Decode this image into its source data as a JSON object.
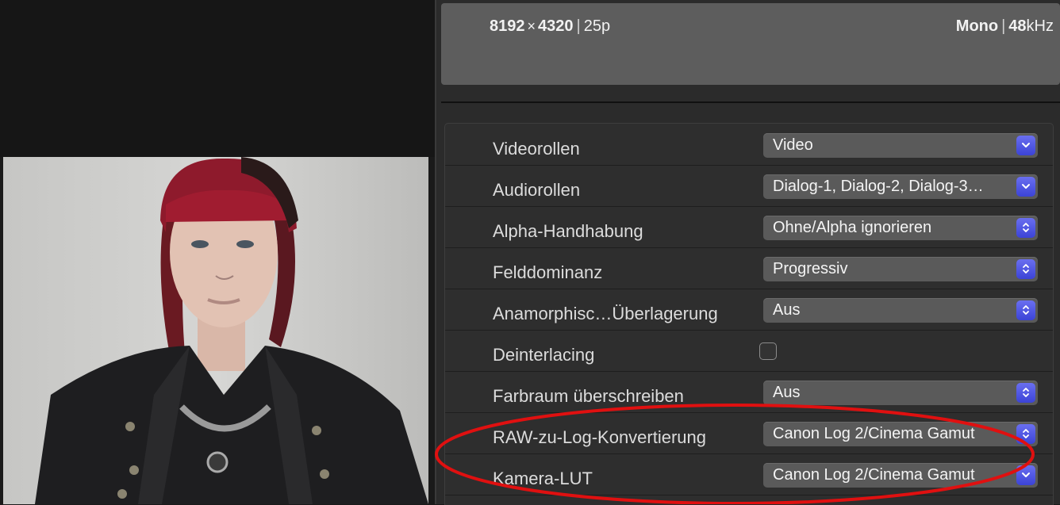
{
  "header": {
    "width": "8192",
    "times": "×",
    "height": "4320",
    "sep": "|",
    "framerate": "25p",
    "channels": "Mono",
    "samplerate_value": "48",
    "samplerate_unit": "kHz"
  },
  "properties": [
    {
      "label": "Videorollen",
      "value": "Video",
      "control": "dropdown"
    },
    {
      "label": "Audiorollen",
      "value": "Dialog-1, Dialog-2, Dialog-3…",
      "control": "dropdown"
    },
    {
      "label": "Alpha-Handhabung",
      "value": "Ohne/Alpha ignorieren",
      "control": "popup"
    },
    {
      "label": "Felddominanz",
      "value": "Progressiv",
      "control": "popup"
    },
    {
      "label": "Anamorphisc…Überlagerung",
      "value": "Aus",
      "control": "popup"
    },
    {
      "label": "Deinterlacing",
      "value": "",
      "control": "checkbox",
      "checked": false
    },
    {
      "label": "Farbraum überschreiben",
      "value": "Aus",
      "control": "popup"
    },
    {
      "label": "RAW-zu-Log-Konvertierung",
      "value": "Canon Log 2/Cinema Gamut",
      "control": "popup"
    },
    {
      "label": "Kamera-LUT",
      "value": "Canon Log 2/Cinema Gamut",
      "control": "dropdown"
    }
  ],
  "colors": {
    "accent": "#4a52e6",
    "annotation": "#e01010"
  },
  "icons": {
    "dropdown": "chevron-down-icon",
    "popup": "up-down-chevron-icon"
  }
}
